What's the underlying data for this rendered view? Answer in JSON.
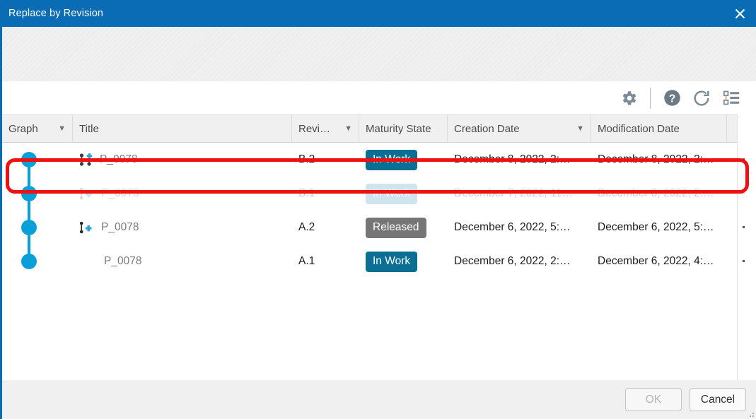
{
  "window": {
    "title": "Replace by Revision",
    "close_icon": "close-icon"
  },
  "toolbar": {
    "items": [
      {
        "name": "settings-icon",
        "label": "Settings"
      },
      {
        "name": "help-icon",
        "label": "Help"
      },
      {
        "name": "refresh-icon",
        "label": "Refresh"
      },
      {
        "name": "tree-view-icon",
        "label": "Tree View"
      }
    ]
  },
  "table": {
    "columns": [
      {
        "label": "Graph",
        "sortable": true,
        "sort_caret": "▼"
      },
      {
        "label": "Title",
        "sortable": false,
        "sort_caret": ""
      },
      {
        "label": "Revi…",
        "sortable": true,
        "sort_caret": "▼"
      },
      {
        "label": "Maturity State",
        "sortable": false,
        "sort_caret": ""
      },
      {
        "label": "Creation Date",
        "sortable": true,
        "sort_caret": "▼"
      },
      {
        "label": "Modification Date",
        "sortable": false,
        "sort_caret": ""
      }
    ],
    "rows": [
      {
        "title": "P_0078",
        "revision": "B.2",
        "maturity": "In Work",
        "maturity_style": "inwork",
        "creation_date": "December 8, 2022, 2:…",
        "modification_date": "December 8, 2022, 2:…",
        "icon": "structure-add-icon",
        "dimmed": false,
        "highlighted": true
      },
      {
        "title": "P_0078",
        "revision": "B.1",
        "maturity": "In Work",
        "maturity_style": "inwork",
        "creation_date": "December 7, 2022, 11…",
        "modification_date": "December 8, 2022, 2:…",
        "icon": "part-add-icon",
        "dimmed": true,
        "highlighted": false
      },
      {
        "title": "P_0078",
        "revision": "A.2",
        "maturity": "Released",
        "maturity_style": "released",
        "creation_date": "December 6, 2022, 5:…",
        "modification_date": "December 6, 2022, 5:…",
        "icon": "part-add-icon",
        "dimmed": false,
        "highlighted": false
      },
      {
        "title": "P_0078",
        "revision": "A.1",
        "maturity": "In Work",
        "maturity_style": "inwork",
        "creation_date": "December 6, 2022, 2:…",
        "modification_date": "December 6, 2022, 4:…",
        "icon": "none",
        "dimmed": false,
        "highlighted": false
      }
    ]
  },
  "footer": {
    "ok_label": "OK",
    "cancel_label": "Cancel",
    "ok_enabled": false
  },
  "colors": {
    "titlebar": "#0a6cb4",
    "node_blue": "#0a9fd8",
    "badge_inwork": "#0a6f93",
    "badge_released": "#767676",
    "annotation_red": "#ee1111"
  }
}
